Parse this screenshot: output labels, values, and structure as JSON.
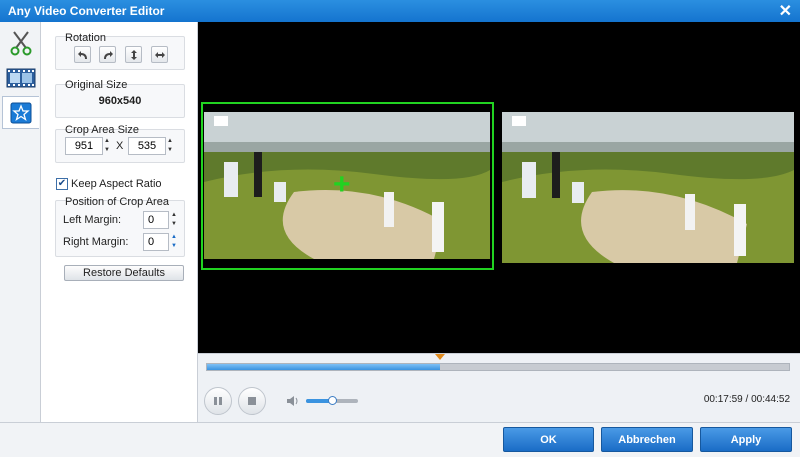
{
  "window": {
    "title": "Any Video Converter Editor"
  },
  "tools": [
    "scissors-icon",
    "filmstrip-icon",
    "star-effect-icon"
  ],
  "rotation": {
    "title": "Rotation"
  },
  "original_size": {
    "title": "Original Size",
    "value": "960x540"
  },
  "crop_area_size": {
    "title": "Crop Area Size",
    "width": "951",
    "separator": "X",
    "height": "535"
  },
  "keep_aspect": {
    "label": "Keep Aspect Ratio",
    "checked": true
  },
  "position": {
    "title": "Position of Crop Area",
    "left_label": "Left Margin:",
    "left_value": "0",
    "right_label": "Right Margin:",
    "right_value": "0"
  },
  "restore_label": "Restore Defaults",
  "player": {
    "time": "00:17:59 / 00:44:52",
    "progress": 0.4,
    "volume": 0.5
  },
  "footer": {
    "ok": "OK",
    "cancel": "Abbrechen",
    "apply": "Apply"
  },
  "colors": {
    "accent": "#1a6cc6",
    "crop": "#21d321",
    "titlebar": "#1e7fd8"
  }
}
